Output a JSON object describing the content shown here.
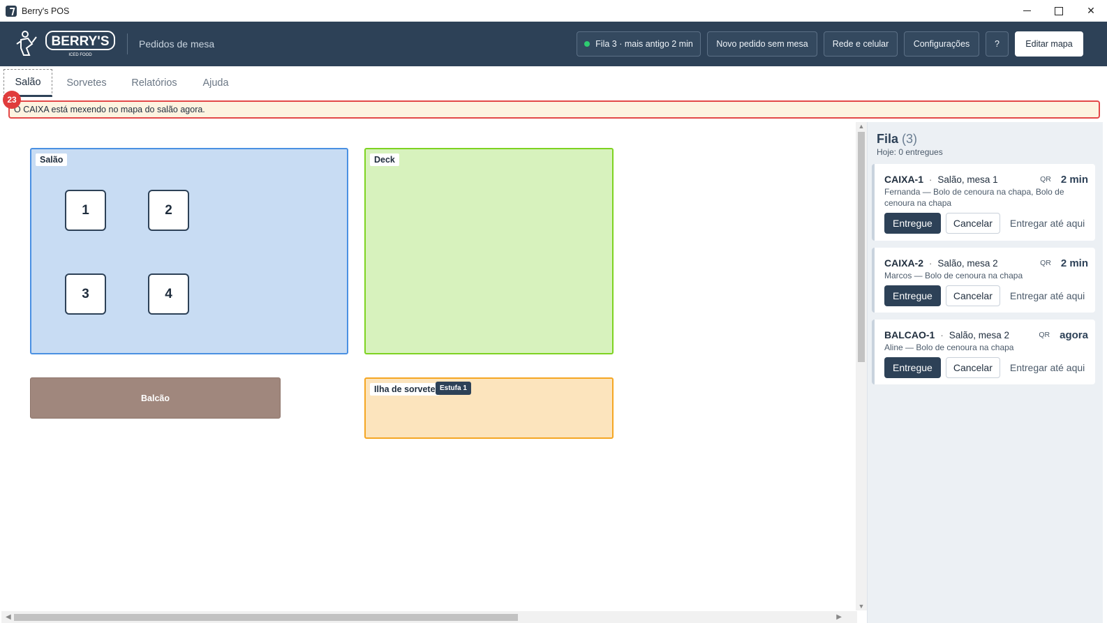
{
  "window": {
    "title": "Berry's POS",
    "close_glyph": "✕"
  },
  "header": {
    "logo_name": "BERRY'S",
    "logo_tagline": "ICED FOOD",
    "subtitle": "Pedidos de mesa",
    "queue_status": "Fila 3 · mais antigo 2 min",
    "new_order_label": "Novo pedido sem mesa",
    "network_label": "Rede e celular",
    "settings_label": "Configurações",
    "help_label": "?",
    "edit_map_label": "Editar mapa"
  },
  "tabs": [
    {
      "label": "Salão",
      "active": true
    },
    {
      "label": "Sorvetes",
      "active": false
    },
    {
      "label": "Relatórios",
      "active": false
    },
    {
      "label": "Ajuda",
      "active": false
    }
  ],
  "notice": {
    "badge": "23",
    "text": "O CAIXA está mexendo no mapa do salão agora."
  },
  "map": {
    "zones": {
      "salao": "Salão",
      "deck": "Deck",
      "balcao": "Balcão",
      "ilha": "Ilha de sorvete",
      "ilha_tag": "Estufa 1"
    },
    "tables": [
      "1",
      "2",
      "3",
      "4"
    ]
  },
  "queue": {
    "title": "Fila",
    "count": "(3)",
    "today": "Hoje: 0 entregues",
    "orders": [
      {
        "code": "CAIXA-1",
        "sep": "·",
        "where": "Salão, mesa 1",
        "qr": "QR",
        "time": "2 min",
        "desc": "Fernanda — Bolo de cenoura na chapa, Bolo de cenoura na chapa",
        "deliver": "Entregue",
        "cancel": "Cancelar",
        "deliver_until": "Entregar até aqui"
      },
      {
        "code": "CAIXA-2",
        "sep": "·",
        "where": "Salão, mesa 2",
        "qr": "QR",
        "time": "2 min",
        "desc": "Marcos — Bolo de cenoura na chapa",
        "deliver": "Entregue",
        "cancel": "Cancelar",
        "deliver_until": "Entregar até aqui"
      },
      {
        "code": "BALCAO-1",
        "sep": "·",
        "where": "Salão, mesa 2",
        "qr": "QR",
        "time": "agora",
        "desc": "Aline — Bolo de cenoura na chapa",
        "deliver": "Entregue",
        "cancel": "Cancelar",
        "deliver_until": "Entregar até aqui"
      }
    ]
  },
  "colors": {
    "header_bg": "#2d4157",
    "salao_zone": "#c8dcf3",
    "deck_zone": "#d7f2bd",
    "balcao_zone": "#a0877d",
    "ilha_zone": "#fce4bd",
    "alert": "#e34848",
    "status_ok": "#2ecc71"
  }
}
